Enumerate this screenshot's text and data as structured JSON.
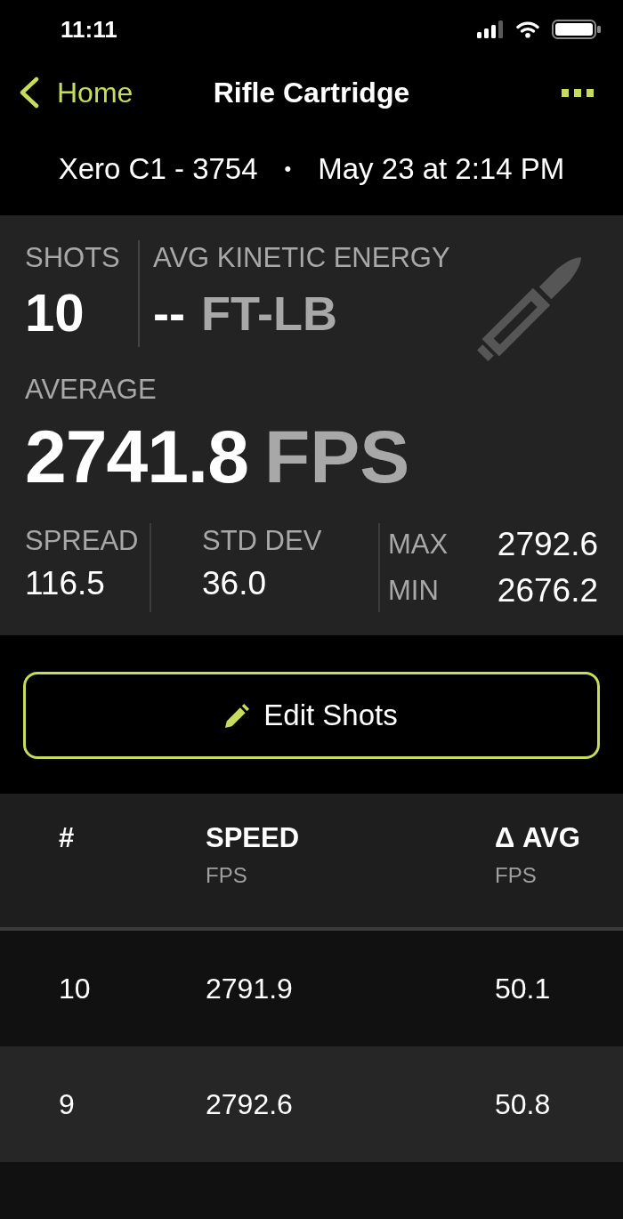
{
  "status_bar": {
    "time": "11:11"
  },
  "nav_bar": {
    "back_label": "Home",
    "title": "Rifle Cartridge"
  },
  "session": {
    "device": "Xero C1 - 3754",
    "separator": "•",
    "date": "May 23 at 2:14 PM"
  },
  "summary": {
    "shots": {
      "label": "SHOTS",
      "value": "10"
    },
    "kinetic_energy": {
      "label": "AVG KINETIC ENERGY",
      "value": "--",
      "unit": "FT-LB"
    },
    "average": {
      "label": "AVERAGE",
      "value": "2741.8",
      "unit": "FPS"
    },
    "stats": [
      {
        "label": "SPREAD",
        "value": "116.5"
      },
      {
        "label": "STD DEV",
        "value": "36.0"
      }
    ],
    "range": [
      {
        "label": "MAX",
        "value": "2792.6"
      },
      {
        "label": "MIN",
        "value": "2676.2"
      }
    ]
  },
  "edit_button": {
    "label": "Edit Shots"
  },
  "table": {
    "columns": [
      {
        "title": "#"
      },
      {
        "title": "SPEED",
        "unit": "FPS"
      },
      {
        "title": "Δ AVG",
        "unit": "FPS"
      }
    ],
    "rows": [
      {
        "cells": [
          "10",
          "2791.9",
          "50.1"
        ]
      },
      {
        "cells": [
          "9",
          "2792.6",
          "50.8"
        ]
      }
    ]
  }
}
